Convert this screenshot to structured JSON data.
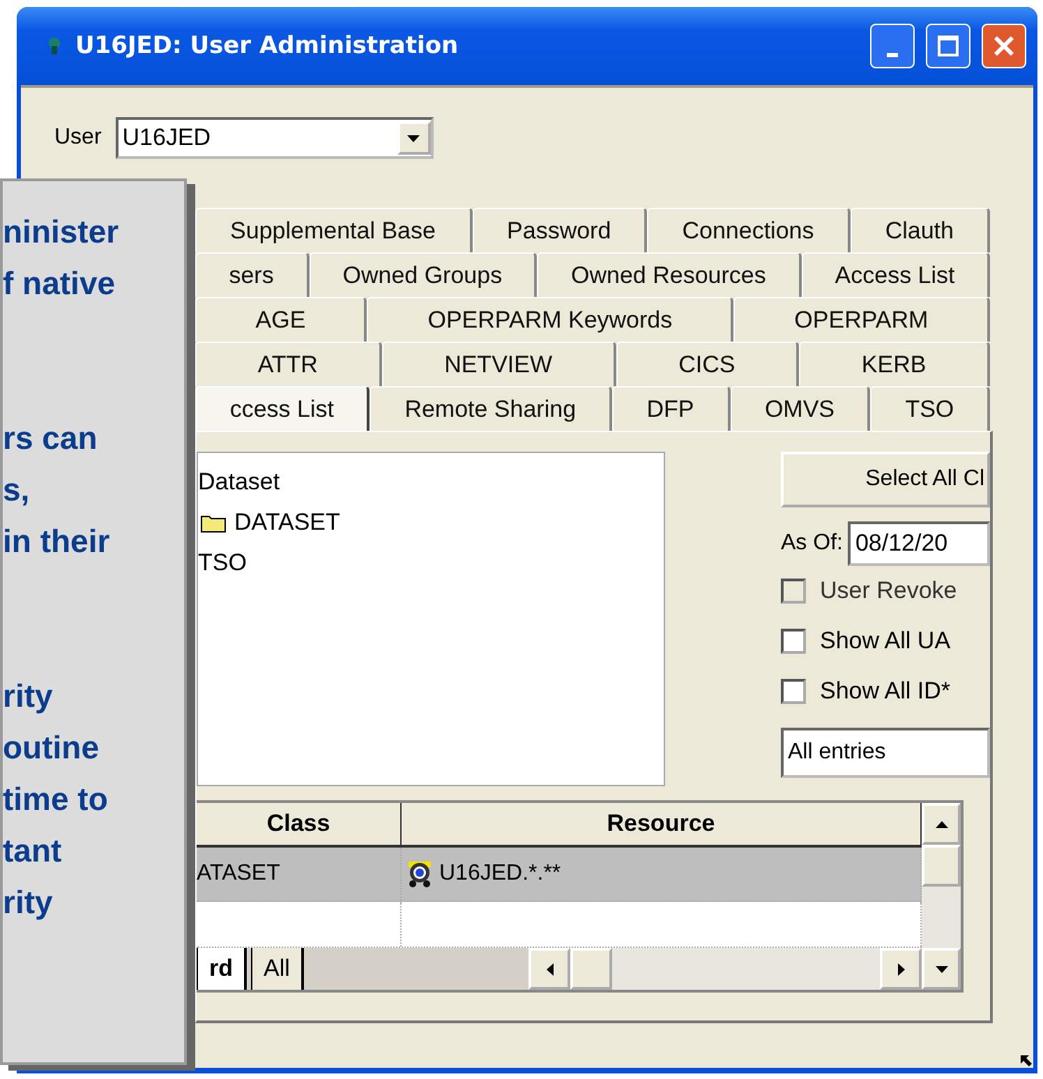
{
  "window": {
    "title": "U16JED: User Administration"
  },
  "user": {
    "label": "User",
    "value": "U16JED"
  },
  "tab_rows": [
    [
      {
        "label": "Supplemental Base",
        "selected": false
      },
      {
        "label": "Password",
        "selected": false
      },
      {
        "label": "Connections",
        "selected": false
      },
      {
        "label": "Clauth",
        "selected": false
      }
    ],
    [
      {
        "label": "sers",
        "selected": false
      },
      {
        "label": "Owned Groups",
        "selected": false
      },
      {
        "label": "Owned Resources",
        "selected": false
      },
      {
        "label": "Access List",
        "selected": false
      }
    ],
    [
      {
        "label": "AGE",
        "selected": false
      },
      {
        "label": "OPERPARM Keywords",
        "selected": false
      },
      {
        "label": "OPERPARM",
        "selected": false
      }
    ],
    [
      {
        "label": "ATTR",
        "selected": false
      },
      {
        "label": "NETVIEW",
        "selected": false
      },
      {
        "label": "CICS",
        "selected": false
      },
      {
        "label": "KERB",
        "selected": false
      }
    ],
    [
      {
        "label": "ccess List",
        "selected": true
      },
      {
        "label": "Remote Sharing",
        "selected": false
      },
      {
        "label": "DFP",
        "selected": false
      },
      {
        "label": "OMVS",
        "selected": false
      },
      {
        "label": "TSO",
        "selected": false
      }
    ]
  ],
  "tree": [
    {
      "label": "Dataset",
      "children": [
        {
          "label": "DATASET",
          "kind": "folder"
        }
      ]
    },
    {
      "label": "TSO"
    }
  ],
  "select_button": "Select All Cl",
  "as_of": {
    "label": "As Of:",
    "value": "08/12/20"
  },
  "checkboxes": [
    {
      "label": "User Revoke",
      "checked": false,
      "disabled": true
    },
    {
      "label": "Show All UA",
      "checked": false,
      "disabled": false
    },
    {
      "label": "Show All ID*",
      "checked": false,
      "disabled": false
    }
  ],
  "filter": "All entries",
  "grid": {
    "columns": [
      "Class",
      "Resource"
    ],
    "rows": [
      {
        "cells": [
          "ATASET",
          "U16JED.*.**"
        ],
        "selected": true
      }
    ],
    "sheet_tabs": [
      {
        "label": "rd",
        "selected": true
      },
      {
        "label": "All",
        "selected": false
      }
    ]
  },
  "callout": {
    "paragraphs": [
      [
        "ninister",
        "f native"
      ],
      [
        "rs can",
        "s,",
        "in their"
      ],
      [
        "rity",
        "outine",
        "time to",
        "tant",
        "rity"
      ]
    ]
  }
}
